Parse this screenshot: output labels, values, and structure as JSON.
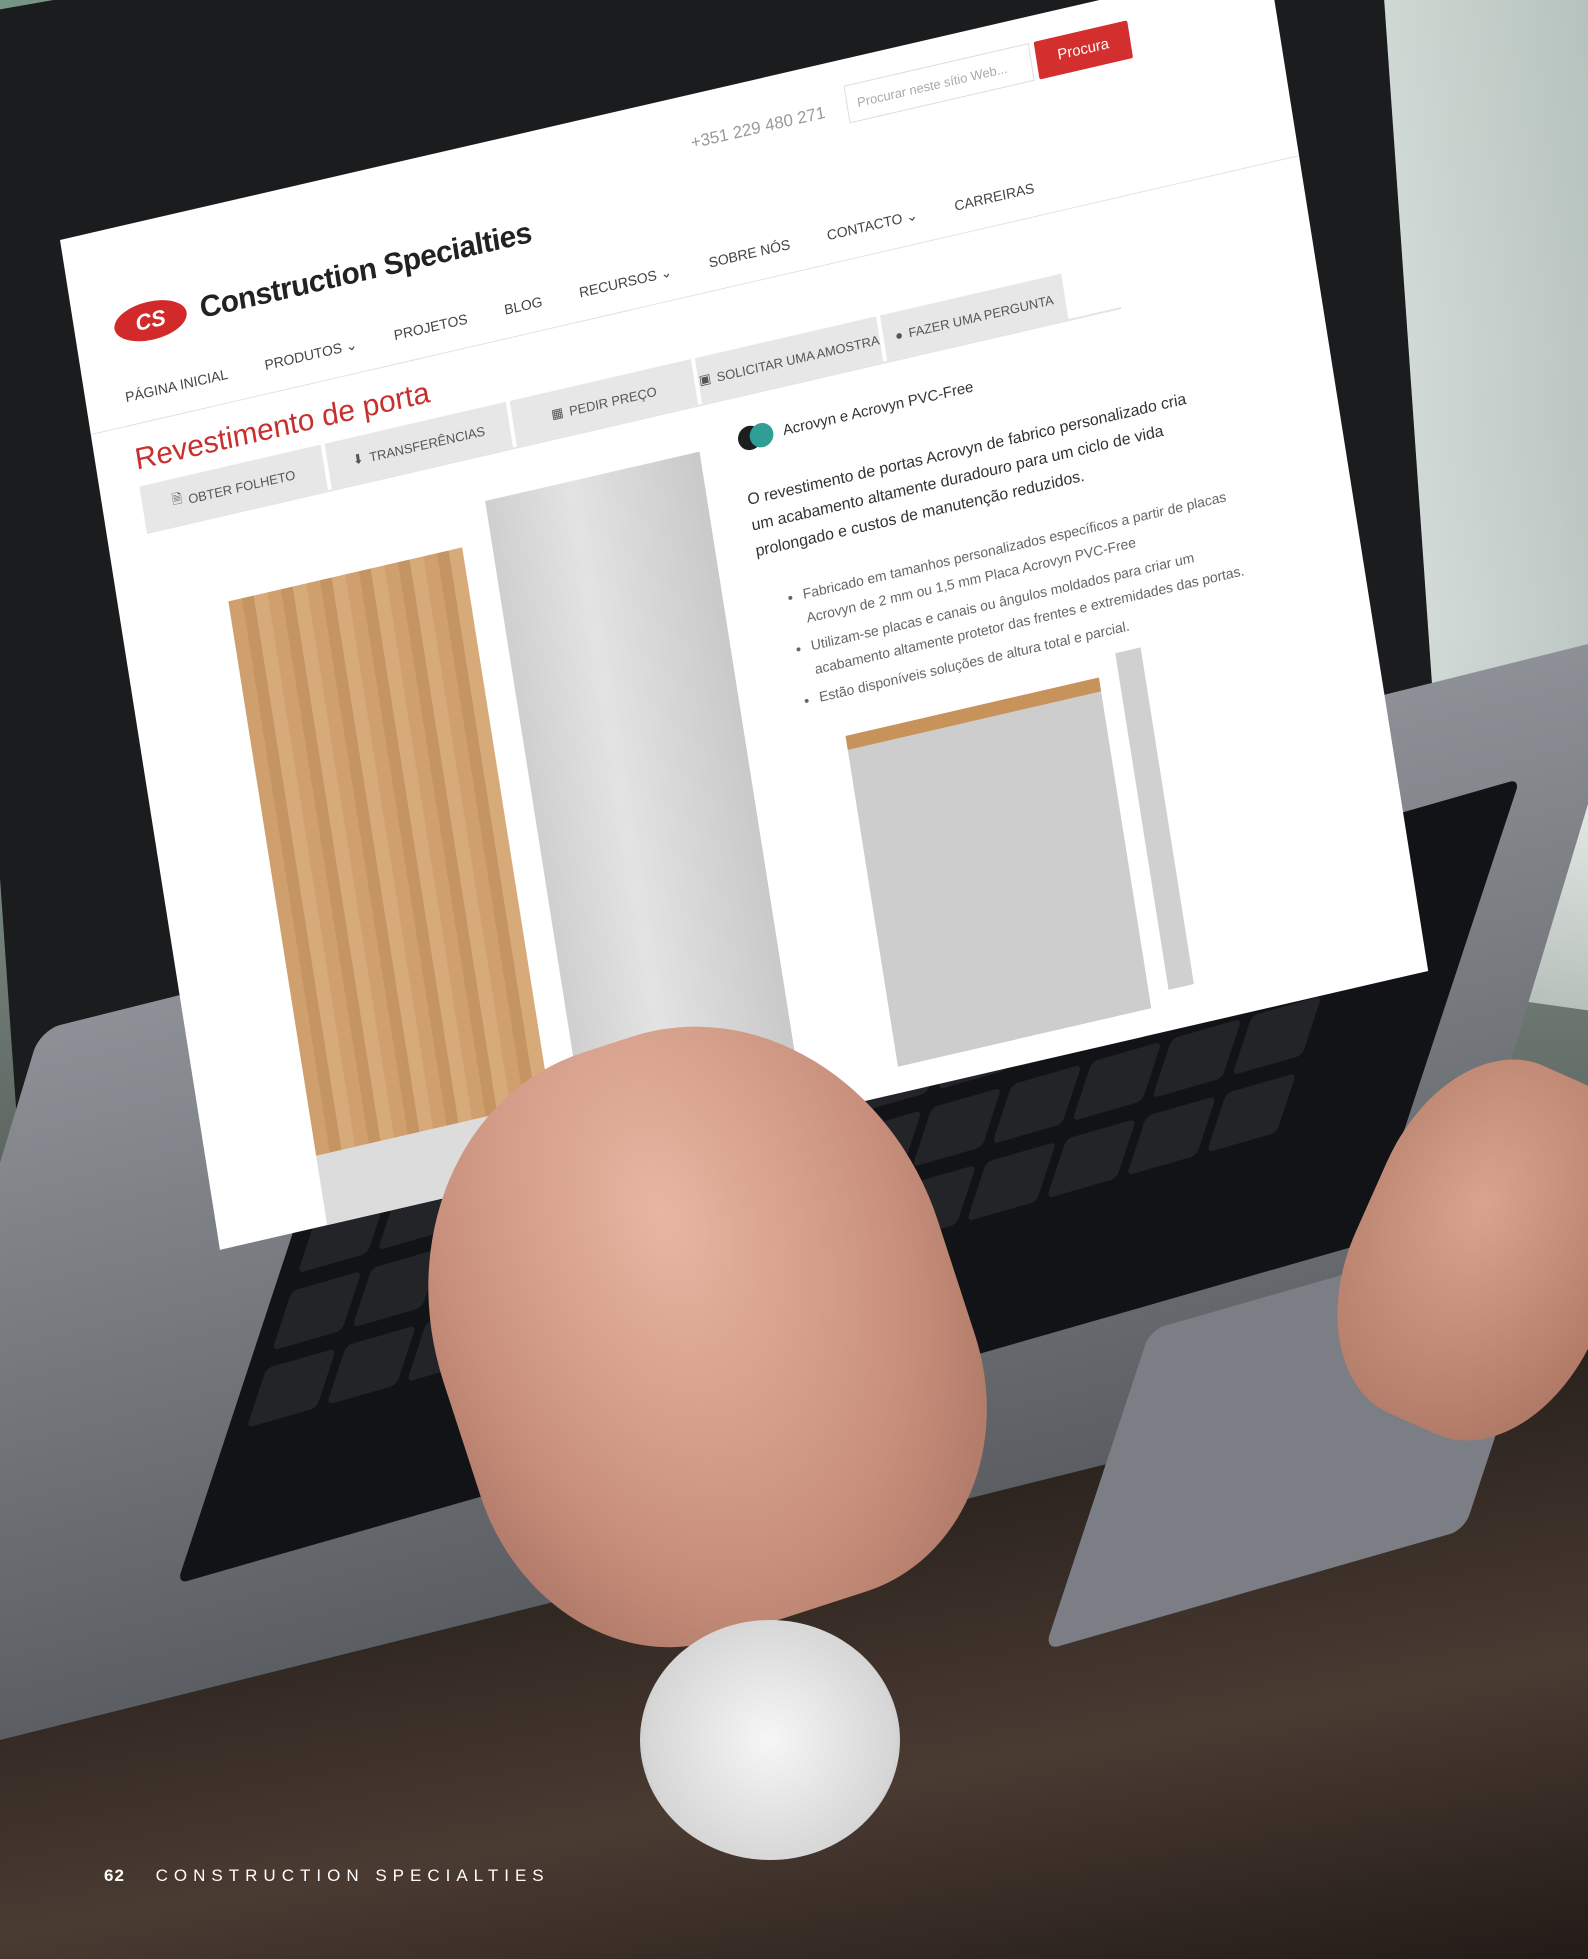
{
  "site": {
    "phone": "+351 229 480 271",
    "search_placeholder": "Procurar neste sítio Web...",
    "search_button": "Procura",
    "logo_mark": "CS",
    "logo_text": "Construction Specialties"
  },
  "nav": {
    "items": [
      "PÁGINA INICIAL",
      "PRODUTOS ⌄",
      "PROJETOS",
      "BLOG",
      "RECURSOS ⌄",
      "SOBRE NÓS",
      "CONTACTO ⌄",
      "CARREIRAS"
    ]
  },
  "page": {
    "title": "Revestimento de porta",
    "tabs": [
      "OBTER FOLHETO",
      "TRANSFERÊNCIAS",
      "PEDIR PREÇO",
      "SOLICITAR UMA AMOSTRA",
      "FAZER UMA PERGUNTA"
    ],
    "material": "Acrovyn e Acrovyn PVC-Free",
    "description": "O revestimento de portas Acrovyn de fabrico personalizado cria um acabamento altamente duradouro para um ciclo de vida prolongado e custos de manutenção reduzidos.",
    "bullets": [
      "Fabricado em tamanhos personalizados específicos a partir de placas Acrovyn de 2 mm ou 1,5 mm Placa Acrovyn PVC-Free",
      "Utilizam-se placas e canais ou ângulos moldados para criar um acabamento altamente protetor das frentes e extremidades das portas.",
      "Estão disponíveis soluções de altura total e parcial."
    ]
  },
  "colors": {
    "brand_red": "#d22a2a",
    "title_red": "#c8302f",
    "swatch_dark": "#1d1f1f",
    "swatch_teal": "#2f9e95"
  },
  "footer": {
    "page_number": "62",
    "publication": "CONSTRUCTION SPECIALTIES"
  }
}
